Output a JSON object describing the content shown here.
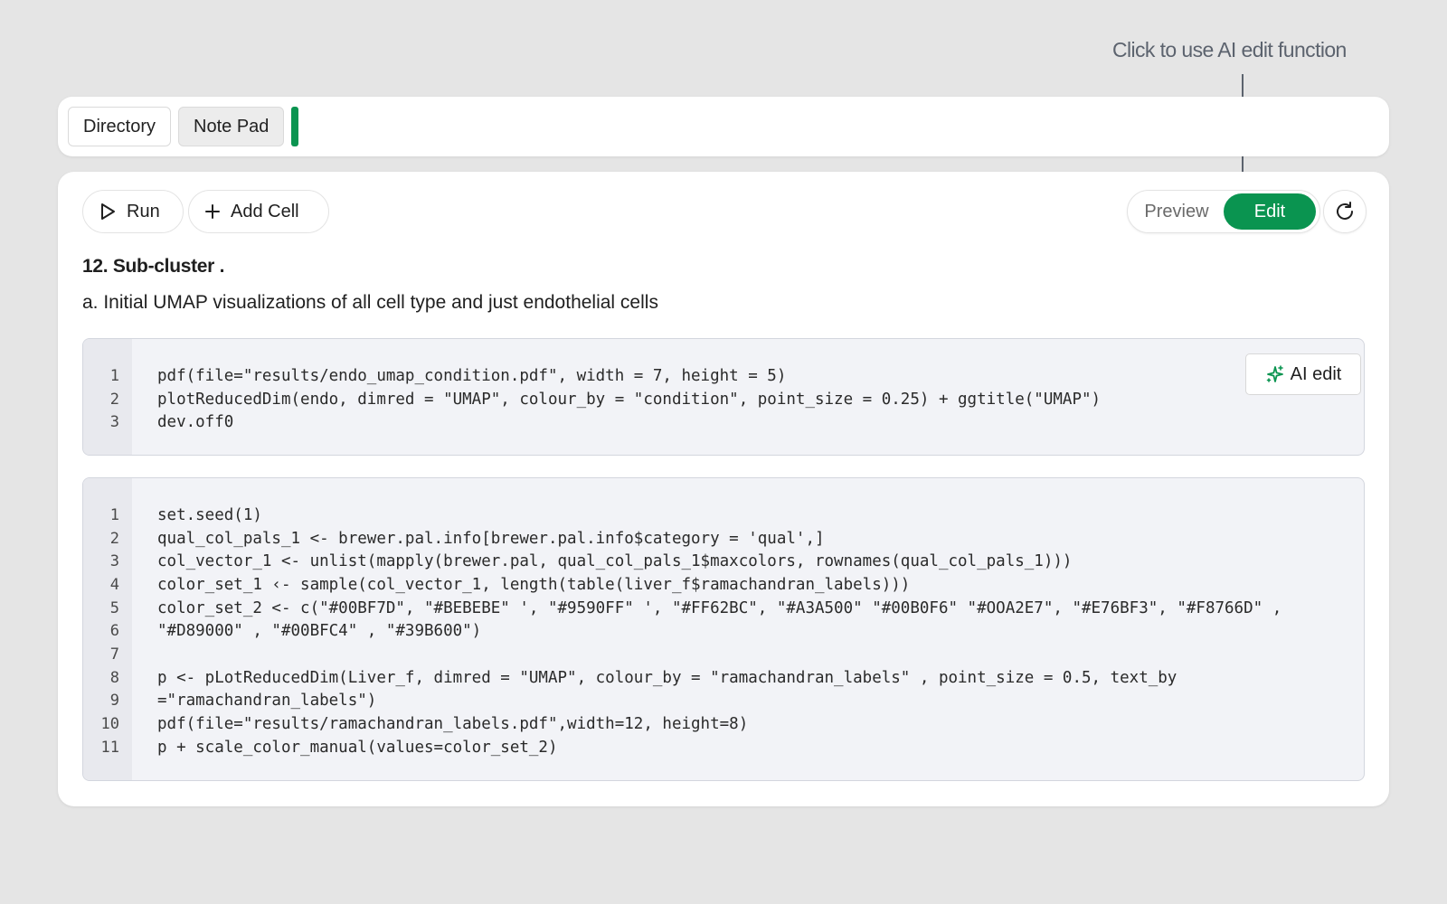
{
  "annotation": {
    "text": "Click to use AI edit function"
  },
  "tabs": [
    {
      "label": "Directory"
    },
    {
      "label": "Note Pad"
    }
  ],
  "toolbar": {
    "run_label": "Run",
    "add_cell_label": "Add Cell",
    "preview_label": "Preview",
    "edit_label": "Edit"
  },
  "notebook": {
    "heading": "12. Sub-cluster .",
    "subheading": "a. Initial UMAP visualizations of all cell type and just endothelial cells"
  },
  "cell_actions": {
    "ai_edit_label": "AI edit",
    "ai_icon": "sparkle-icon",
    "delete_icon": "trash-icon"
  },
  "cells": [
    {
      "lines": [
        {
          "n": "1",
          "code": "pdf(file=\"results/endo_umap_condition.pdf\", width = 7, height = 5)"
        },
        {
          "n": "2",
          "code": "plotReducedDim(endo, dimred = \"UMAP\", colour_by = \"condition\", point_size = 0.25) + ggtitle(\"UMAP\")"
        },
        {
          "n": "3",
          "code": "dev.off0"
        }
      ]
    },
    {
      "lines": [
        {
          "n": "1",
          "code": "set.seed(1)"
        },
        {
          "n": "2",
          "code": "qual_col_pals_1 <- brewer.pal.info[brewer.pal.info$category = 'qual',]"
        },
        {
          "n": "3",
          "code": "col_vector_1 <- unlist(mapply(brewer.pal, qual_col_pals_1$maxcolors, rownames(qual_col_pals_1)))"
        },
        {
          "n": "4",
          "code": "color_set_1 ‹- sample(col_vector_1, length(table(liver_f$ramachandran_labels)))"
        },
        {
          "n": "5",
          "code": "color_set_2 <- c(\"#00BF7D\", \"#BEBEBE\" ', \"#9590FF\" ', \"#FF62BC\", \"#A3A500\" \"#00B0F6\" \"#OOA2E7\", \"#E76BF3\", \"#F8766D\" ,"
        },
        {
          "n": "6",
          "code": "\"#D89000\" , \"#00BFC4\" , \"#39B600\")"
        },
        {
          "n": "7",
          "code": ""
        },
        {
          "n": "8",
          "code": "p <- pLotReducedDim(Liver_f, dimred = \"UMAP\", colour_by = \"ramachandran_labels\" , point_size = 0.5, text_by"
        },
        {
          "n": "9",
          "code": "=\"ramachandran_labels\")"
        },
        {
          "n": "10",
          "code": "pdf(file=\"results/ramachandran_labels.pdf\",width=12, height=8)"
        },
        {
          "n": "11",
          "code": "p + scale_color_manual(values=color_set_2)"
        }
      ]
    }
  ],
  "colors": {
    "accent": "#0a9450",
    "danger": "#e53935",
    "background": "#e5e5e5"
  }
}
